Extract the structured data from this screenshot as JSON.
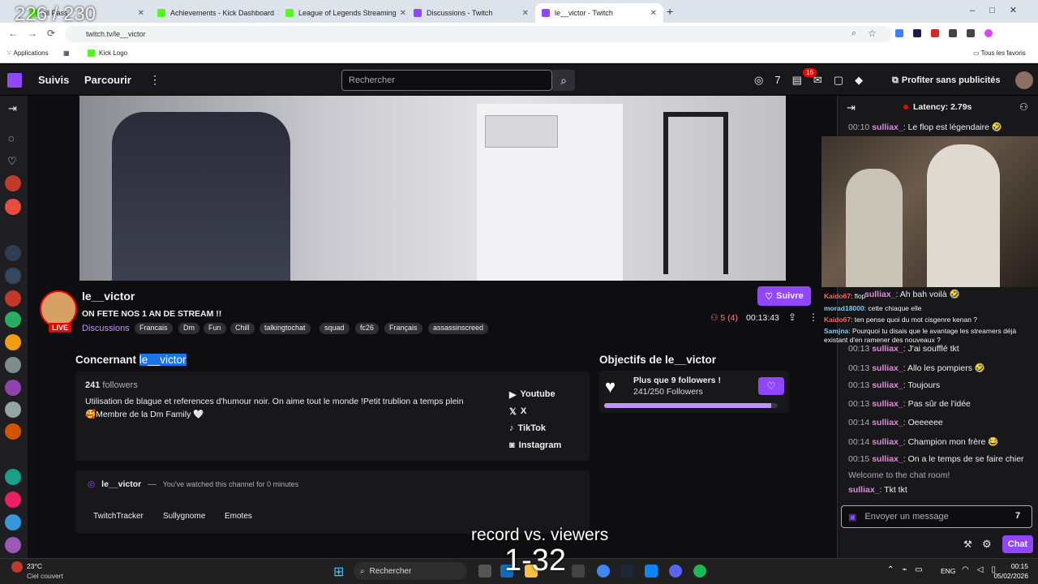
{
  "overlay": {
    "counter": "226 / 230",
    "caption": "record vs. viewers",
    "number": "1-32"
  },
  "browser": {
    "tabs": [
      {
        "label": "all Pass",
        "color": "#53fc18"
      },
      {
        "label": "Achievements - Kick Dashboard",
        "color": "#53fc18"
      },
      {
        "label": "League of Legends Streaming",
        "color": "#53fc18"
      },
      {
        "label": "Discussions - Twitch",
        "color": "#9146ff"
      },
      {
        "label": "le__victor - Twitch",
        "color": "#9146ff"
      }
    ],
    "url": "twitch.tv/le__victor",
    "bookmarks": {
      "apps": "Applications",
      "kick": "Kick Logo",
      "all": "Tous les favoris"
    }
  },
  "nav": {
    "following": "Suivis",
    "browse": "Parcourir",
    "search_placeholder": "Rechercher",
    "notif_count": "16",
    "ad_free": "Profiter sans publicités"
  },
  "channel": {
    "name": "le__victor",
    "title": "ON FETE NOS 1 AN DE STREAM !!",
    "live": "LIVE",
    "category": "Discussions",
    "tags": [
      "Francais",
      "Dm",
      "Fun",
      "Chill",
      "talkingtochat",
      "squad",
      "fc26",
      "Français",
      "assassinscreed"
    ],
    "follow": "Suivre",
    "viewers": "5 (4)",
    "uptime": "00:13:43"
  },
  "about": {
    "heading_prefix": "Concernant ",
    "heading_name": "le__victor",
    "followers_count": "241",
    "followers_label": " followers",
    "bio_line1": "Utilisation de blague et references d'humour noir. On aime tout le monde !Petit trublion a temps plein",
    "bio_line2": "🥰Membre de la Dm Family 🤍",
    "socials": [
      "Youtube",
      "X",
      "TikTok",
      "Instagram"
    ]
  },
  "goals": {
    "heading": "Objectifs de le__victor",
    "title": "Plus que 9 followers !",
    "count": "241/250 Followers",
    "progress": 0.964
  },
  "extension": {
    "name": "le__victor",
    "note": "You've watched this channel for 0 minutes",
    "tabs": [
      "TwitchTracker",
      "Sullygnome",
      "Emotes"
    ]
  },
  "chat": {
    "latency": "Latency: 2.79s",
    "messages": [
      {
        "t": "00:10",
        "u": "sulliax_",
        "m": ": Le flop est légendaire 🤣"
      },
      {
        "t": "00:12",
        "u": "sulliax_",
        "m": ": Ah bah voilà 🤣"
      },
      {
        "t": "00:13",
        "u": "sulliax_",
        "m": ": J'ai soufflé tkt"
      },
      {
        "t": "00:13",
        "u": "sulliax_",
        "m": ": Allo les pompiers 🤣"
      },
      {
        "t": "00:13",
        "u": "sulliax_",
        "m": ": Toujours"
      },
      {
        "t": "00:13",
        "u": "sulliax_",
        "m": ": Pas sûr de l'idée"
      },
      {
        "t": "00:14",
        "u": "sulliax_",
        "m": ": Oeeeeee"
      },
      {
        "t": "00:14",
        "u": "sulliax_",
        "m": ": Champion mon frère 😂"
      },
      {
        "t": "00:15",
        "u": "sulliax_",
        "m": ": On a le temps de se faire chier"
      }
    ],
    "welcome": "Welcome to the chat room!",
    "last": {
      "u": "sulliax_",
      "m": ": Tkt tkt"
    },
    "overlay_msgs": [
      {
        "u": "Kaido67",
        "m": ": flop"
      },
      {
        "u": "morad18000",
        "m": ": cette chiaque elle"
      },
      {
        "u": "Kaido67",
        "m": ": ten pense quoi du mot cisgenre kenan ?"
      },
      {
        "u": "Samjna",
        "m": ": Pourquoi tu disais que le avantage les streamers déjà existant d'en ramener des nouveaux ?"
      }
    ],
    "input_placeholder": "Envoyer un message",
    "send": "Chat"
  },
  "taskbar": {
    "weather_temp": "23°C",
    "weather_desc": "Ciel couvert",
    "search": "Rechercher",
    "lang": "ENG",
    "time": "00:15",
    "date": "05/02/2026"
  }
}
